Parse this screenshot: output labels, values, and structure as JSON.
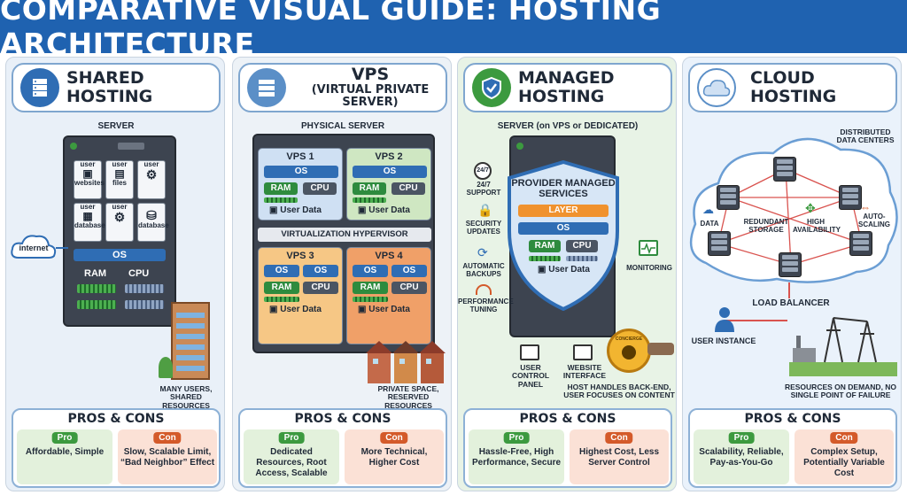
{
  "title": "COMPARATIVE VISUAL GUIDE: HOSTING ARCHITECTURE",
  "colors": {
    "banner": "#1f62b0",
    "pro": "#3c9a3f",
    "con": "#d45a2a",
    "os": "#2f6db4",
    "ram": "#2e8b3e"
  },
  "shared": {
    "title": "SHARED HOSTING",
    "icon": "server-stack-icon",
    "server": "SERVER",
    "tiles": [
      {
        "top": "user",
        "bottom": "websites"
      },
      {
        "top": "user",
        "bottom": "files"
      },
      {
        "top": "user",
        "bottom": ""
      },
      {
        "top": "user",
        "bottom": "database"
      },
      {
        "top": "user",
        "bottom": ""
      },
      {
        "top": "",
        "bottom": "database"
      }
    ],
    "internet": "internet",
    "os": "OS",
    "ram": "RAM",
    "cpu": "CPU",
    "caption": "MANY USERS, SHARED RESOURCES",
    "pros_title": "PROS & CONS",
    "pro_tag": "Pro",
    "con_tag": "Con",
    "pro": "Affordable, Simple",
    "con": "Slow, Scalable Limit, “Bad Neighbor” Effect"
  },
  "vps": {
    "title": "VPS",
    "subtitle": "(VIRTUAL PRIVATE SERVER)",
    "icon": "server-stack-icon",
    "server": "PHYSICAL SERVER",
    "vps1": "VPS 1",
    "vps2": "VPS 2",
    "vps3": "VPS 3",
    "vps4": "VPS 4",
    "os": "OS",
    "ram": "RAM",
    "cpu": "CPU",
    "user_data": "User Data",
    "hypervisor": "VIRTUALIZATION HYPERVISOR",
    "caption": "PRIVATE SPACE, RESERVED RESOURCES",
    "pros_title": "PROS & CONS",
    "pro_tag": "Pro",
    "con_tag": "Con",
    "pro": "Dedicated Resources, Root Access, Scalable",
    "con": "More Technical, Higher Cost"
  },
  "managed": {
    "title": "MANAGED HOSTING",
    "icon": "shield-check-icon",
    "server": "SERVER (on VPS or DEDICATED)",
    "support": "24/7 SUPPORT",
    "support_badge": "24/7",
    "security": "SECURITY UPDATES",
    "backups": "AUTOMATIC BACKUPS",
    "tuning": "PERFORMANCE TUNING",
    "monitoring": "MONITORING",
    "shield_title": "PROVIDER MANAGED SERVICES",
    "layer": "LAYER",
    "os": "OS",
    "ram": "RAM",
    "cpu": "CPU",
    "user_data": "User Data",
    "panel": "USER CONTROL PANEL",
    "web": "WEBSITE INTERFACE",
    "concierge": "CONCIERGE",
    "caption": "HOST HANDLES BACK-END, USER FOCUSES ON CONTENT",
    "pros_title": "PROS & CONS",
    "pro_tag": "Pro",
    "con_tag": "Con",
    "pro": "Hassle-Free, High Performance, Secure",
    "con": "Highest Cost, Less Server Control"
  },
  "cloud": {
    "title": "CLOUD HOSTING",
    "icon": "cloud-icon",
    "dcs": "DISTRIBUTED DATA CENTERS",
    "data": "DATA",
    "redundant": "REDUNDANT STORAGE",
    "ha": "HIGH AVAILABILITY",
    "auto": "AUTO-SCALING",
    "lb": "LOAD BALANCER",
    "user": "USER INSTANCE",
    "caption": "RESOURCES ON DEMAND, NO SINGLE POINT OF FAILURE",
    "pros_title": "PROS & CONS",
    "pro_tag": "Pro",
    "con_tag": "Con",
    "pro": "Scalability, Reliable, Pay-as-You-Go",
    "con": "Complex Setup, Potentially Variable Cost"
  }
}
